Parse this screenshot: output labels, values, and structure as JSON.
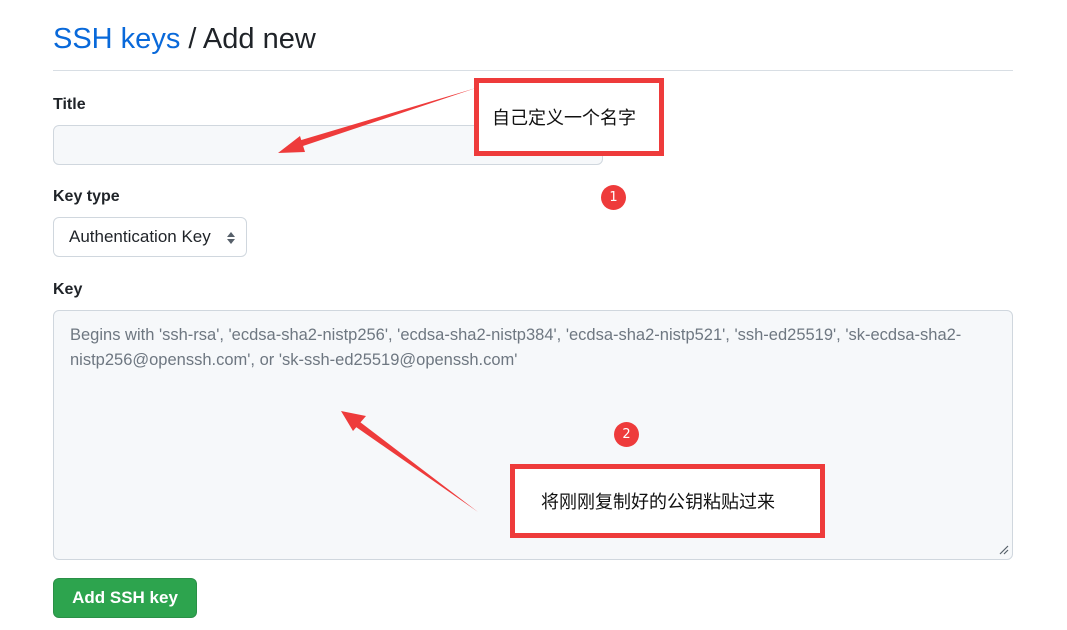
{
  "breadcrumb": {
    "parent": "SSH keys",
    "separator": "/",
    "current": "Add new"
  },
  "form": {
    "title_label": "Title",
    "title_value": "",
    "key_type_label": "Key type",
    "key_type_value": "Authentication Key",
    "key_label": "Key",
    "key_value": "",
    "key_placeholder": "Begins with 'ssh-rsa', 'ecdsa-sha2-nistp256', 'ecdsa-sha2-nistp384', 'ecdsa-sha2-nistp521', 'ssh-ed25519', 'sk-ecdsa-sha2-nistp256@openssh.com', or 'sk-ssh-ed25519@openssh.com'",
    "submit_label": "Add SSH key"
  },
  "annotations": {
    "note_1": "自己定义一个名字",
    "badge_1": "1",
    "note_2": "将刚刚复制好的公钥粘贴过来",
    "badge_2": "2"
  },
  "colors": {
    "link": "#0969da",
    "primary_button": "#2da44e",
    "annotation_red": "#ee3b3b",
    "input_bg": "#f6f8fa",
    "border": "#d0d7de"
  },
  "icons": {
    "select_caret": "updown-caret-icon",
    "resize_grip": "resize-grip-icon",
    "arrows": "annotation-arrow-icon"
  }
}
